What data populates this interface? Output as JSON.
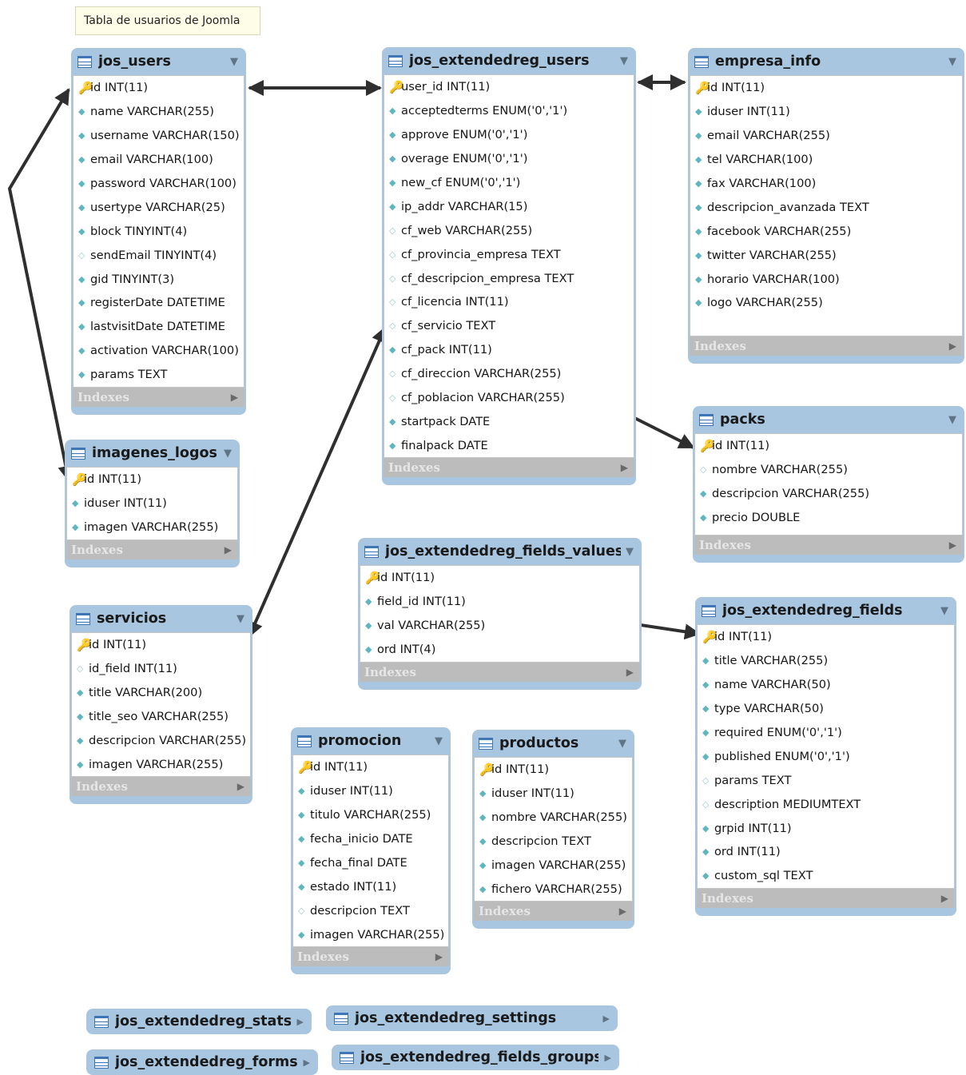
{
  "note": "Tabla de usuarios de Joomla",
  "indexes_label": "Indexes",
  "tables": [
    {
      "id": "jos_users",
      "title": "jos_users",
      "columns": [
        {
          "key": true,
          "label": "id INT(11)"
        },
        {
          "key": false,
          "label": "name VARCHAR(255)"
        },
        {
          "key": false,
          "label": "username VARCHAR(150)"
        },
        {
          "key": false,
          "label": "email VARCHAR(100)"
        },
        {
          "key": false,
          "label": "password VARCHAR(100)"
        },
        {
          "key": false,
          "label": "usertype VARCHAR(25)"
        },
        {
          "key": false,
          "label": "block TINYINT(4)"
        },
        {
          "key": false,
          "label": "sendEmail TINYINT(4)",
          "open": true
        },
        {
          "key": false,
          "label": "gid TINYINT(3)"
        },
        {
          "key": false,
          "label": "registerDate DATETIME"
        },
        {
          "key": false,
          "label": "lastvisitDate DATETIME"
        },
        {
          "key": false,
          "label": "activation VARCHAR(100)"
        },
        {
          "key": false,
          "label": "params TEXT"
        }
      ]
    },
    {
      "id": "jos_extendedreg_users",
      "title": "jos_extendedreg_users",
      "columns": [
        {
          "key": true,
          "label": "user_id INT(11)"
        },
        {
          "key": false,
          "label": "acceptedterms ENUM('0','1')"
        },
        {
          "key": false,
          "label": "approve ENUM('0','1')"
        },
        {
          "key": false,
          "label": "overage ENUM('0','1')"
        },
        {
          "key": false,
          "label": "new_cf ENUM('0','1')"
        },
        {
          "key": false,
          "label": "ip_addr VARCHAR(15)"
        },
        {
          "key": false,
          "label": "cf_web VARCHAR(255)",
          "open": true
        },
        {
          "key": false,
          "label": "cf_provincia_empresa TEXT",
          "open": true
        },
        {
          "key": false,
          "label": "cf_descripcion_empresa TEXT",
          "open": true
        },
        {
          "key": false,
          "label": "cf_licencia INT(11)",
          "open": true
        },
        {
          "key": false,
          "label": "cf_servicio TEXT",
          "open": true
        },
        {
          "key": false,
          "label": "cf_pack INT(11)"
        },
        {
          "key": false,
          "label": "cf_direccion VARCHAR(255)",
          "open": true
        },
        {
          "key": false,
          "label": "cf_poblacion VARCHAR(255)",
          "open": true
        },
        {
          "key": false,
          "label": "startpack DATE"
        },
        {
          "key": false,
          "label": "finalpack DATE"
        }
      ]
    },
    {
      "id": "empresa_info",
      "title": "empresa_info",
      "columns": [
        {
          "key": true,
          "label": "id INT(11)"
        },
        {
          "key": false,
          "label": "iduser INT(11)"
        },
        {
          "key": false,
          "label": "email VARCHAR(255)"
        },
        {
          "key": false,
          "label": "tel VARCHAR(100)"
        },
        {
          "key": false,
          "label": "fax VARCHAR(100)"
        },
        {
          "key": false,
          "label": "descripcion_avanzada TEXT"
        },
        {
          "key": false,
          "label": "facebook VARCHAR(255)"
        },
        {
          "key": false,
          "label": "twitter VARCHAR(255)"
        },
        {
          "key": false,
          "label": "horario VARCHAR(100)"
        },
        {
          "key": false,
          "label": "logo VARCHAR(255)"
        }
      ]
    },
    {
      "id": "packs",
      "title": "packs",
      "columns": [
        {
          "key": true,
          "label": "id INT(11)"
        },
        {
          "key": false,
          "label": "nombre VARCHAR(255)",
          "open": true
        },
        {
          "key": false,
          "label": "descripcion VARCHAR(255)"
        },
        {
          "key": false,
          "label": "precio DOUBLE"
        }
      ]
    },
    {
      "id": "imagenes_logos",
      "title": "imagenes_logos",
      "columns": [
        {
          "key": true,
          "label": "id INT(11)"
        },
        {
          "key": false,
          "label": "iduser INT(11)"
        },
        {
          "key": false,
          "label": "imagen VARCHAR(255)"
        }
      ]
    },
    {
      "id": "jos_extendedreg_fields_values",
      "title": "jos_extendedreg_fields_values",
      "columns": [
        {
          "key": true,
          "label": "id INT(11)"
        },
        {
          "key": false,
          "label": "field_id INT(11)"
        },
        {
          "key": false,
          "label": "val VARCHAR(255)"
        },
        {
          "key": false,
          "label": "ord INT(4)"
        }
      ]
    },
    {
      "id": "jos_extendedreg_fields",
      "title": "jos_extendedreg_fields",
      "columns": [
        {
          "key": true,
          "label": "id INT(11)"
        },
        {
          "key": false,
          "label": "title VARCHAR(255)"
        },
        {
          "key": false,
          "label": "name VARCHAR(50)"
        },
        {
          "key": false,
          "label": "type VARCHAR(50)"
        },
        {
          "key": false,
          "label": "required ENUM('0','1')"
        },
        {
          "key": false,
          "label": "published ENUM('0','1')"
        },
        {
          "key": false,
          "label": "params TEXT",
          "open": true
        },
        {
          "key": false,
          "label": "description MEDIUMTEXT",
          "open": true
        },
        {
          "key": false,
          "label": "grpid INT(11)"
        },
        {
          "key": false,
          "label": "ord INT(11)"
        },
        {
          "key": false,
          "label": "custom_sql TEXT"
        }
      ]
    },
    {
      "id": "servicios",
      "title": "servicios",
      "columns": [
        {
          "key": true,
          "label": "id INT(11)"
        },
        {
          "key": false,
          "label": "id_field INT(11)",
          "open": true
        },
        {
          "key": false,
          "label": "title VARCHAR(200)"
        },
        {
          "key": false,
          "label": "title_seo VARCHAR(255)"
        },
        {
          "key": false,
          "label": "descripcion VARCHAR(255)"
        },
        {
          "key": false,
          "label": "imagen VARCHAR(255)"
        }
      ]
    },
    {
      "id": "promocion",
      "title": "promocion",
      "columns": [
        {
          "key": true,
          "label": "id INT(11)"
        },
        {
          "key": false,
          "label": "iduser INT(11)"
        },
        {
          "key": false,
          "label": "titulo VARCHAR(255)"
        },
        {
          "key": false,
          "label": "fecha_inicio DATE"
        },
        {
          "key": false,
          "label": "fecha_final DATE"
        },
        {
          "key": false,
          "label": "estado INT(11)"
        },
        {
          "key": false,
          "label": "descripcion TEXT",
          "open": true
        },
        {
          "key": false,
          "label": "imagen VARCHAR(255)"
        }
      ]
    },
    {
      "id": "productos",
      "title": "productos",
      "columns": [
        {
          "key": true,
          "label": "id INT(11)"
        },
        {
          "key": false,
          "label": "iduser INT(11)"
        },
        {
          "key": false,
          "label": "nombre VARCHAR(255)"
        },
        {
          "key": false,
          "label": "descripcion TEXT"
        },
        {
          "key": false,
          "label": "imagen VARCHAR(255)"
        },
        {
          "key": false,
          "label": "fichero VARCHAR(255)"
        }
      ]
    }
  ],
  "collapsed_tables": [
    {
      "id": "jos_extendedreg_stats",
      "title": "jos_extendedreg_stats"
    },
    {
      "id": "jos_extendedreg_settings",
      "title": "jos_extendedreg_settings"
    },
    {
      "id": "jos_extendedreg_forms",
      "title": "jos_extendedreg_forms"
    },
    {
      "id": "jos_extendedreg_fields_groups",
      "title": "jos_extendedreg_fields_groups"
    }
  ]
}
